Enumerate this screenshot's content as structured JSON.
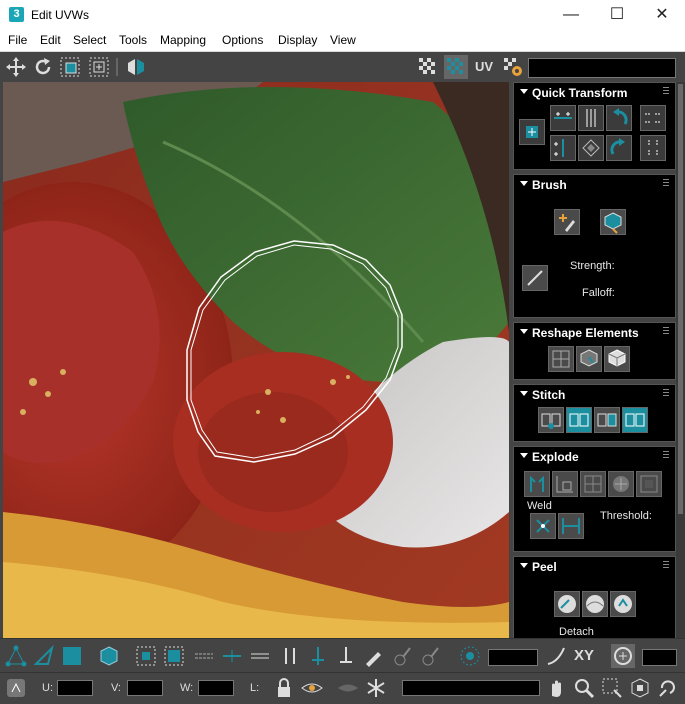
{
  "window": {
    "title": "Edit UVWs",
    "app_icon_text": "3",
    "minimize": "—",
    "maximize": "☐",
    "close": "✕"
  },
  "menu": [
    "File",
    "Edit",
    "Select",
    "Tools",
    "Mapping",
    "Options",
    "Display",
    "View"
  ],
  "toolbar": {
    "uv_label": "UV"
  },
  "rollouts": {
    "quick_transform": {
      "title": "Quick Transform"
    },
    "brush": {
      "title": "Brush",
      "strength_label": "Strength:",
      "falloff_label": "Falloff:"
    },
    "reshape_elements": {
      "title": "Reshape Elements"
    },
    "stitch": {
      "title": "Stitch"
    },
    "explode": {
      "title": "Explode",
      "weld_label": "Weld",
      "threshold_label": "Threshold:"
    },
    "peel": {
      "title": "Peel",
      "detach_label": "Detach"
    }
  },
  "bottom_bar": {
    "xy_label": "XY",
    "u_label": "U:",
    "v_label": "V:",
    "w_label": "W:",
    "l_label": "L:"
  },
  "colors": {
    "accent_cyan": "#1b8fa0",
    "panel_bg": "#444444",
    "rollout_bg": "#000000"
  }
}
